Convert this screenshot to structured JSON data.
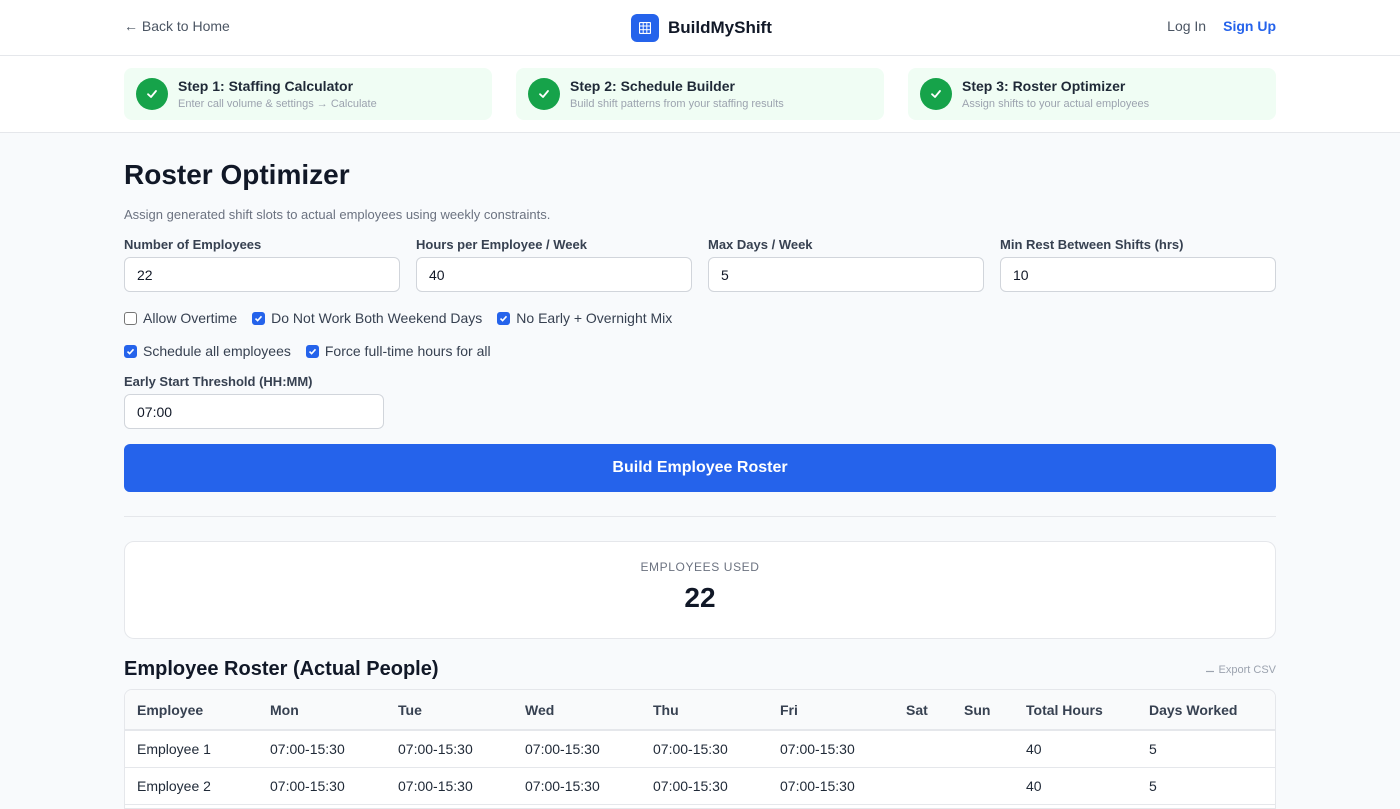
{
  "nav": {
    "back_label": "← Back to Home",
    "brand_name": "BuildMyShift",
    "login_label": "Log In",
    "signup_label": "Sign Up"
  },
  "steps": [
    {
      "title": "Step 1: Staffing Calculator",
      "subtitle": "Enter call volume & settings → Calculate",
      "status": "complete"
    },
    {
      "title": "Step 2: Schedule Builder",
      "subtitle": "Build shift patterns from your staffing results",
      "status": "complete"
    },
    {
      "title": "Step 3: Roster Optimizer",
      "subtitle": "Assign shifts to your actual employees",
      "status": "complete"
    }
  ],
  "page": {
    "title": "Roster Optimizer",
    "description": "Assign generated shift slots to actual employees using weekly constraints."
  },
  "fields": {
    "employees": {
      "label": "Number of Employees",
      "value": "22"
    },
    "hours": {
      "label": "Hours per Employee / Week",
      "value": "40"
    },
    "max_days": {
      "label": "Max Days / Week",
      "value": "5"
    },
    "min_rest": {
      "label": "Min Rest Between Shifts (hrs)",
      "value": "10"
    },
    "early_start": {
      "label": "Early Start Threshold (HH:MM)",
      "value": "07:00"
    }
  },
  "options": {
    "allow_overtime": {
      "label": "Allow Overtime",
      "checked": false
    },
    "no_both_weekend": {
      "label": "Do Not Work Both Weekend Days",
      "checked": true
    },
    "no_early_overnight": {
      "label": "No Early + Overnight Mix",
      "checked": true
    },
    "schedule_all": {
      "label": "Schedule all employees",
      "checked": true
    },
    "force_fulltime": {
      "label": "Force full-time hours for all",
      "checked": true
    }
  },
  "build_button_label": "Build Employee Roster",
  "stats": {
    "employees_used_label": "EMPLOYEES USED",
    "employees_used_value": "22"
  },
  "roster": {
    "title": "Employee Roster (Actual People)",
    "export_label": "Export CSV",
    "columns": [
      "Employee",
      "Mon",
      "Tue",
      "Wed",
      "Thu",
      "Fri",
      "Sat",
      "Sun",
      "Total Hours",
      "Days Worked"
    ],
    "rows": [
      [
        "Employee 1",
        "07:00-15:30",
        "07:00-15:30",
        "07:00-15:30",
        "07:00-15:30",
        "07:00-15:30",
        "",
        "",
        "40",
        "5"
      ],
      [
        "Employee 2",
        "07:00-15:30",
        "07:00-15:30",
        "07:00-15:30",
        "07:00-15:30",
        "07:00-15:30",
        "",
        "",
        "40",
        "5"
      ]
    ]
  },
  "colors": {
    "accent": "#2563eb",
    "success": "#16a34a",
    "step_bg": "#f0fdf4"
  }
}
